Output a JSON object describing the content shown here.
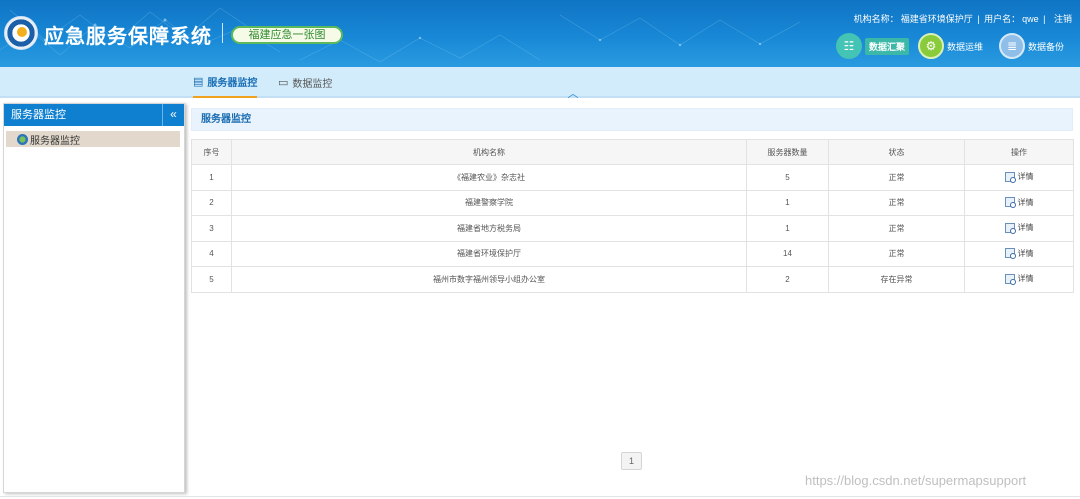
{
  "header": {
    "app_title": "应急服务保障系统",
    "map_button": "福建应急一张图",
    "org_label": "机构名称：",
    "org_value": "福建省环境保护厅",
    "sep1": "|",
    "user_label": "用户名：",
    "user_value": "qwe",
    "sep2": "|",
    "logout": "注销",
    "buttons": [
      {
        "label": "数据汇聚",
        "icon": "data-gather-icon"
      },
      {
        "label": "数据运维",
        "icon": "data-ops-icon"
      },
      {
        "label": "数据备份",
        "icon": "data-backup-icon"
      }
    ]
  },
  "nav": {
    "tabs": [
      {
        "label": "服务器监控",
        "icon": "server-icon",
        "active": true
      },
      {
        "label": "数据监控",
        "icon": "monitor-icon",
        "active": false
      }
    ]
  },
  "sidebar": {
    "title": "服务器监控",
    "collapse_glyph": "«",
    "items": [
      {
        "label": "服务器监控",
        "selected": true
      }
    ]
  },
  "main": {
    "panel_title": "服务器监控",
    "table": {
      "columns": [
        "序号",
        "机构名称",
        "服务器数量",
        "状态",
        "操作"
      ],
      "rows": [
        {
          "no": "1",
          "org": "《福建农业》杂志社",
          "count": "5",
          "status": "正常",
          "action": "详情"
        },
        {
          "no": "2",
          "org": "福建警察学院",
          "count": "1",
          "status": "正常",
          "action": "详情"
        },
        {
          "no": "3",
          "org": "福建省地方税务局",
          "count": "1",
          "status": "正常",
          "action": "详情"
        },
        {
          "no": "4",
          "org": "福建省环境保护厅",
          "count": "14",
          "status": "正常",
          "action": "详情"
        },
        {
          "no": "5",
          "org": "福州市数字福州领导小组办公室",
          "count": "2",
          "status": "存在异常",
          "action": "详情"
        }
      ]
    },
    "pagination": {
      "current": "1"
    }
  },
  "watermark": "https://blog.csdn.net/supermapsupport",
  "colors": {
    "header_blue": "#1888d6",
    "nav_bg": "#d3ecfb",
    "accent_orange": "#f0a21f",
    "map_pill_green": "#5cb85c"
  }
}
